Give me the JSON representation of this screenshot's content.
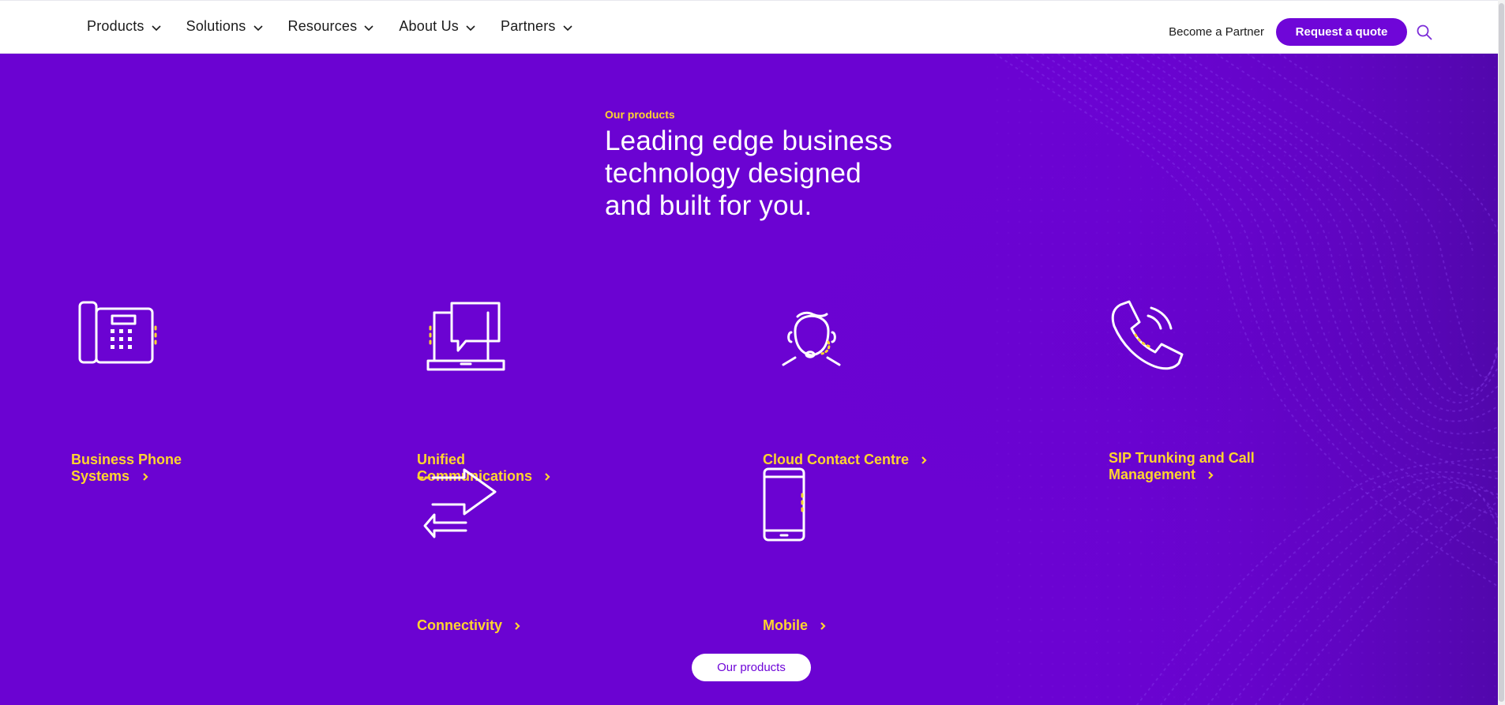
{
  "header": {
    "nav": [
      {
        "label": "Products",
        "icon": "chevron-down-icon"
      },
      {
        "label": "Solutions",
        "icon": "chevron-down-icon"
      },
      {
        "label": "Resources",
        "icon": "chevron-down-icon"
      },
      {
        "label": "About Us",
        "icon": "chevron-down-icon"
      },
      {
        "label": "Partners",
        "icon": "chevron-down-icon"
      }
    ],
    "become_partner": "Become a Partner",
    "request_quote": "Request a quote",
    "search_icon": "search-icon"
  },
  "hero": {
    "eyebrow": "Our products",
    "headline": "Leading edge business\ntechnology designed\nand built for you.",
    "cta": "Our products"
  },
  "products": [
    {
      "label": "Business Phone Systems",
      "icon": "desk-phone-icon"
    },
    {
      "label": "Unified Communications",
      "icon": "laptop-chat-icon"
    },
    {
      "label": "Cloud Contact Centre",
      "icon": "headset-agent-icon"
    },
    {
      "label": "SIP Trunking and Call Management",
      "icon": "phone-handset-icon"
    },
    {
      "label": "Connectivity",
      "icon": "connectivity-arrows-icon"
    },
    {
      "label": "Mobile",
      "icon": "mobile-phone-icon"
    }
  ],
  "colors": {
    "brand_purple": "#6b03d2",
    "button_purple": "#6f06d8",
    "accent_yellow": "#ffd52e",
    "white": "#ffffff"
  }
}
